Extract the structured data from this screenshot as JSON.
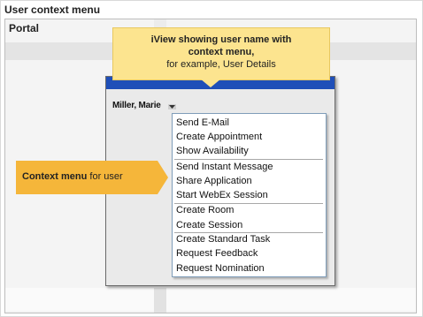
{
  "window": {
    "title": "User context menu"
  },
  "portal": {
    "title": "Portal"
  },
  "iview": {
    "user_name": "Miller, Marie",
    "header_color": "#1f4fb8"
  },
  "context_menu": {
    "items": [
      "Send E-Mail",
      "Create Appointment",
      "Show Availability",
      "Send Instant Message",
      "Share Application",
      "Start WebEx Session",
      "Create Room",
      "Create Session",
      "Create Standard Task",
      "Request Feedback",
      "Request Nomination"
    ]
  },
  "callout_top": {
    "line1": "iView showing user name with",
    "line2": "context menu,",
    "line3": "for example, User Details",
    "color": "#fce48f"
  },
  "callout_left": {
    "bold_text": "Context menu",
    "text": " for user",
    "color": "#f5b63a"
  },
  "icons": {
    "menu_trigger": "dropdown-arrow-icon"
  }
}
